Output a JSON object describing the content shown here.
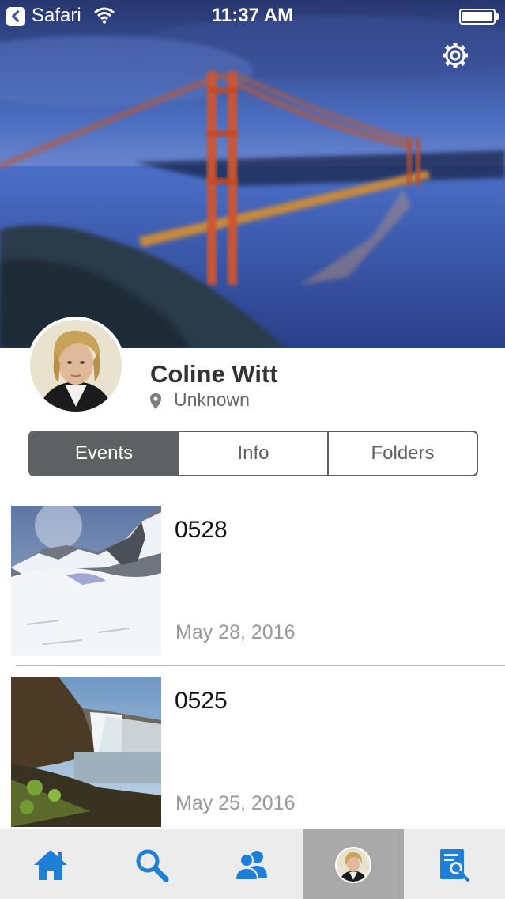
{
  "status_bar": {
    "back_app": "Safari",
    "time": "11:37 AM"
  },
  "header": {
    "cover_image": "golden-gate-bridge-photo",
    "settings_icon": "gear-icon"
  },
  "profile": {
    "name": "Coline Witt",
    "location": "Unknown",
    "location_icon": "map-pin-icon"
  },
  "tabs": [
    {
      "label": "Events",
      "active": true
    },
    {
      "label": "Info",
      "active": false
    },
    {
      "label": "Folders",
      "active": false
    }
  ],
  "events": [
    {
      "title": "0528",
      "date": "May 28, 2016",
      "image": "snowy-mountain-photo"
    },
    {
      "title": "0525",
      "date": "May 25, 2016",
      "image": "waterfall-photo"
    }
  ],
  "tab_bar": {
    "accent_color": "#1f7fd6",
    "selected_bg": "#a9a9a9",
    "items": [
      {
        "icon": "home-icon",
        "selected": false
      },
      {
        "icon": "search-icon",
        "selected": false
      },
      {
        "icon": "people-icon",
        "selected": false
      },
      {
        "icon": "profile-avatar",
        "selected": true
      },
      {
        "icon": "document-search-icon",
        "selected": false
      }
    ]
  }
}
